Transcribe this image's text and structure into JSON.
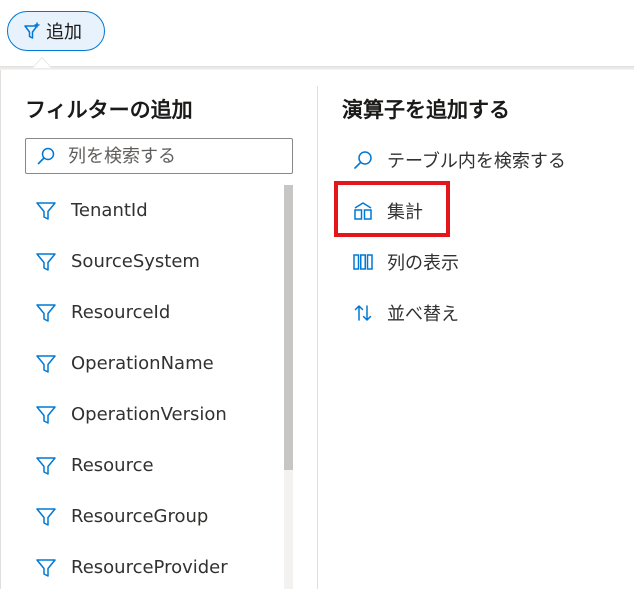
{
  "add_button": {
    "label": "追加",
    "icon": "filter-add-icon"
  },
  "left_panel": {
    "title": "フィルターの追加",
    "search_placeholder": "列を検索する",
    "columns": [
      {
        "label": "TenantId",
        "icon": "filter-icon"
      },
      {
        "label": "SourceSystem",
        "icon": "filter-icon"
      },
      {
        "label": "ResourceId",
        "icon": "filter-icon"
      },
      {
        "label": "OperationName",
        "icon": "filter-icon"
      },
      {
        "label": "OperationVersion",
        "icon": "filter-icon"
      },
      {
        "label": "Resource",
        "icon": "filter-icon"
      },
      {
        "label": "ResourceGroup",
        "icon": "filter-icon"
      },
      {
        "label": "ResourceProvider",
        "icon": "filter-icon"
      }
    ]
  },
  "right_panel": {
    "title": "演算子を追加する",
    "operators": [
      {
        "label": "テーブル内を検索する",
        "icon": "search-icon"
      },
      {
        "label": "集計",
        "icon": "aggregate-icon",
        "highlighted": true
      },
      {
        "label": "列の表示",
        "icon": "columns-icon"
      },
      {
        "label": "並べ替え",
        "icon": "sort-icon"
      }
    ]
  },
  "colors": {
    "accent": "#0078d4",
    "highlight": "#e3161c",
    "text": "#323130"
  }
}
